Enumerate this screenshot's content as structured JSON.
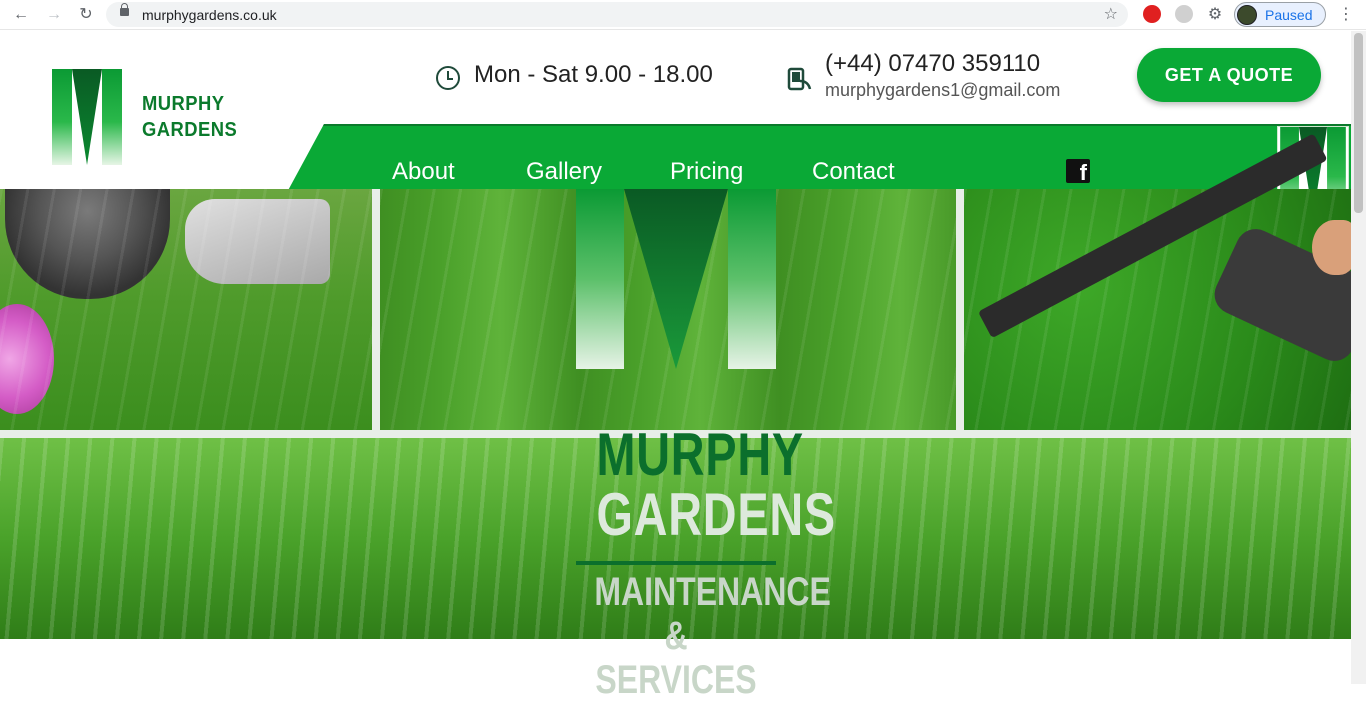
{
  "browser": {
    "url": "murphygardens.co.uk",
    "profile_status": "Paused"
  },
  "logo": {
    "line1": "MURPHY",
    "line2": "GARDENS"
  },
  "header": {
    "hours": "Mon - Sat 9.00 - 18.00",
    "phone": "(+44) 07470 359110",
    "email": "murphygardens1@gmail.com",
    "quote_button": "GET A QUOTE"
  },
  "nav": {
    "items": [
      {
        "label": "About"
      },
      {
        "label": "Gallery"
      },
      {
        "label": "Pricing"
      },
      {
        "label": "Contact"
      }
    ]
  },
  "hero": {
    "name_line1": "MURPHY",
    "name_line2": "GARDENS",
    "tagline_line1": "MAINTENANCE",
    "tagline_line2": "& SERVICES"
  },
  "colors": {
    "brand_green": "#0aa936",
    "dark_green": "#0b6f2c"
  }
}
